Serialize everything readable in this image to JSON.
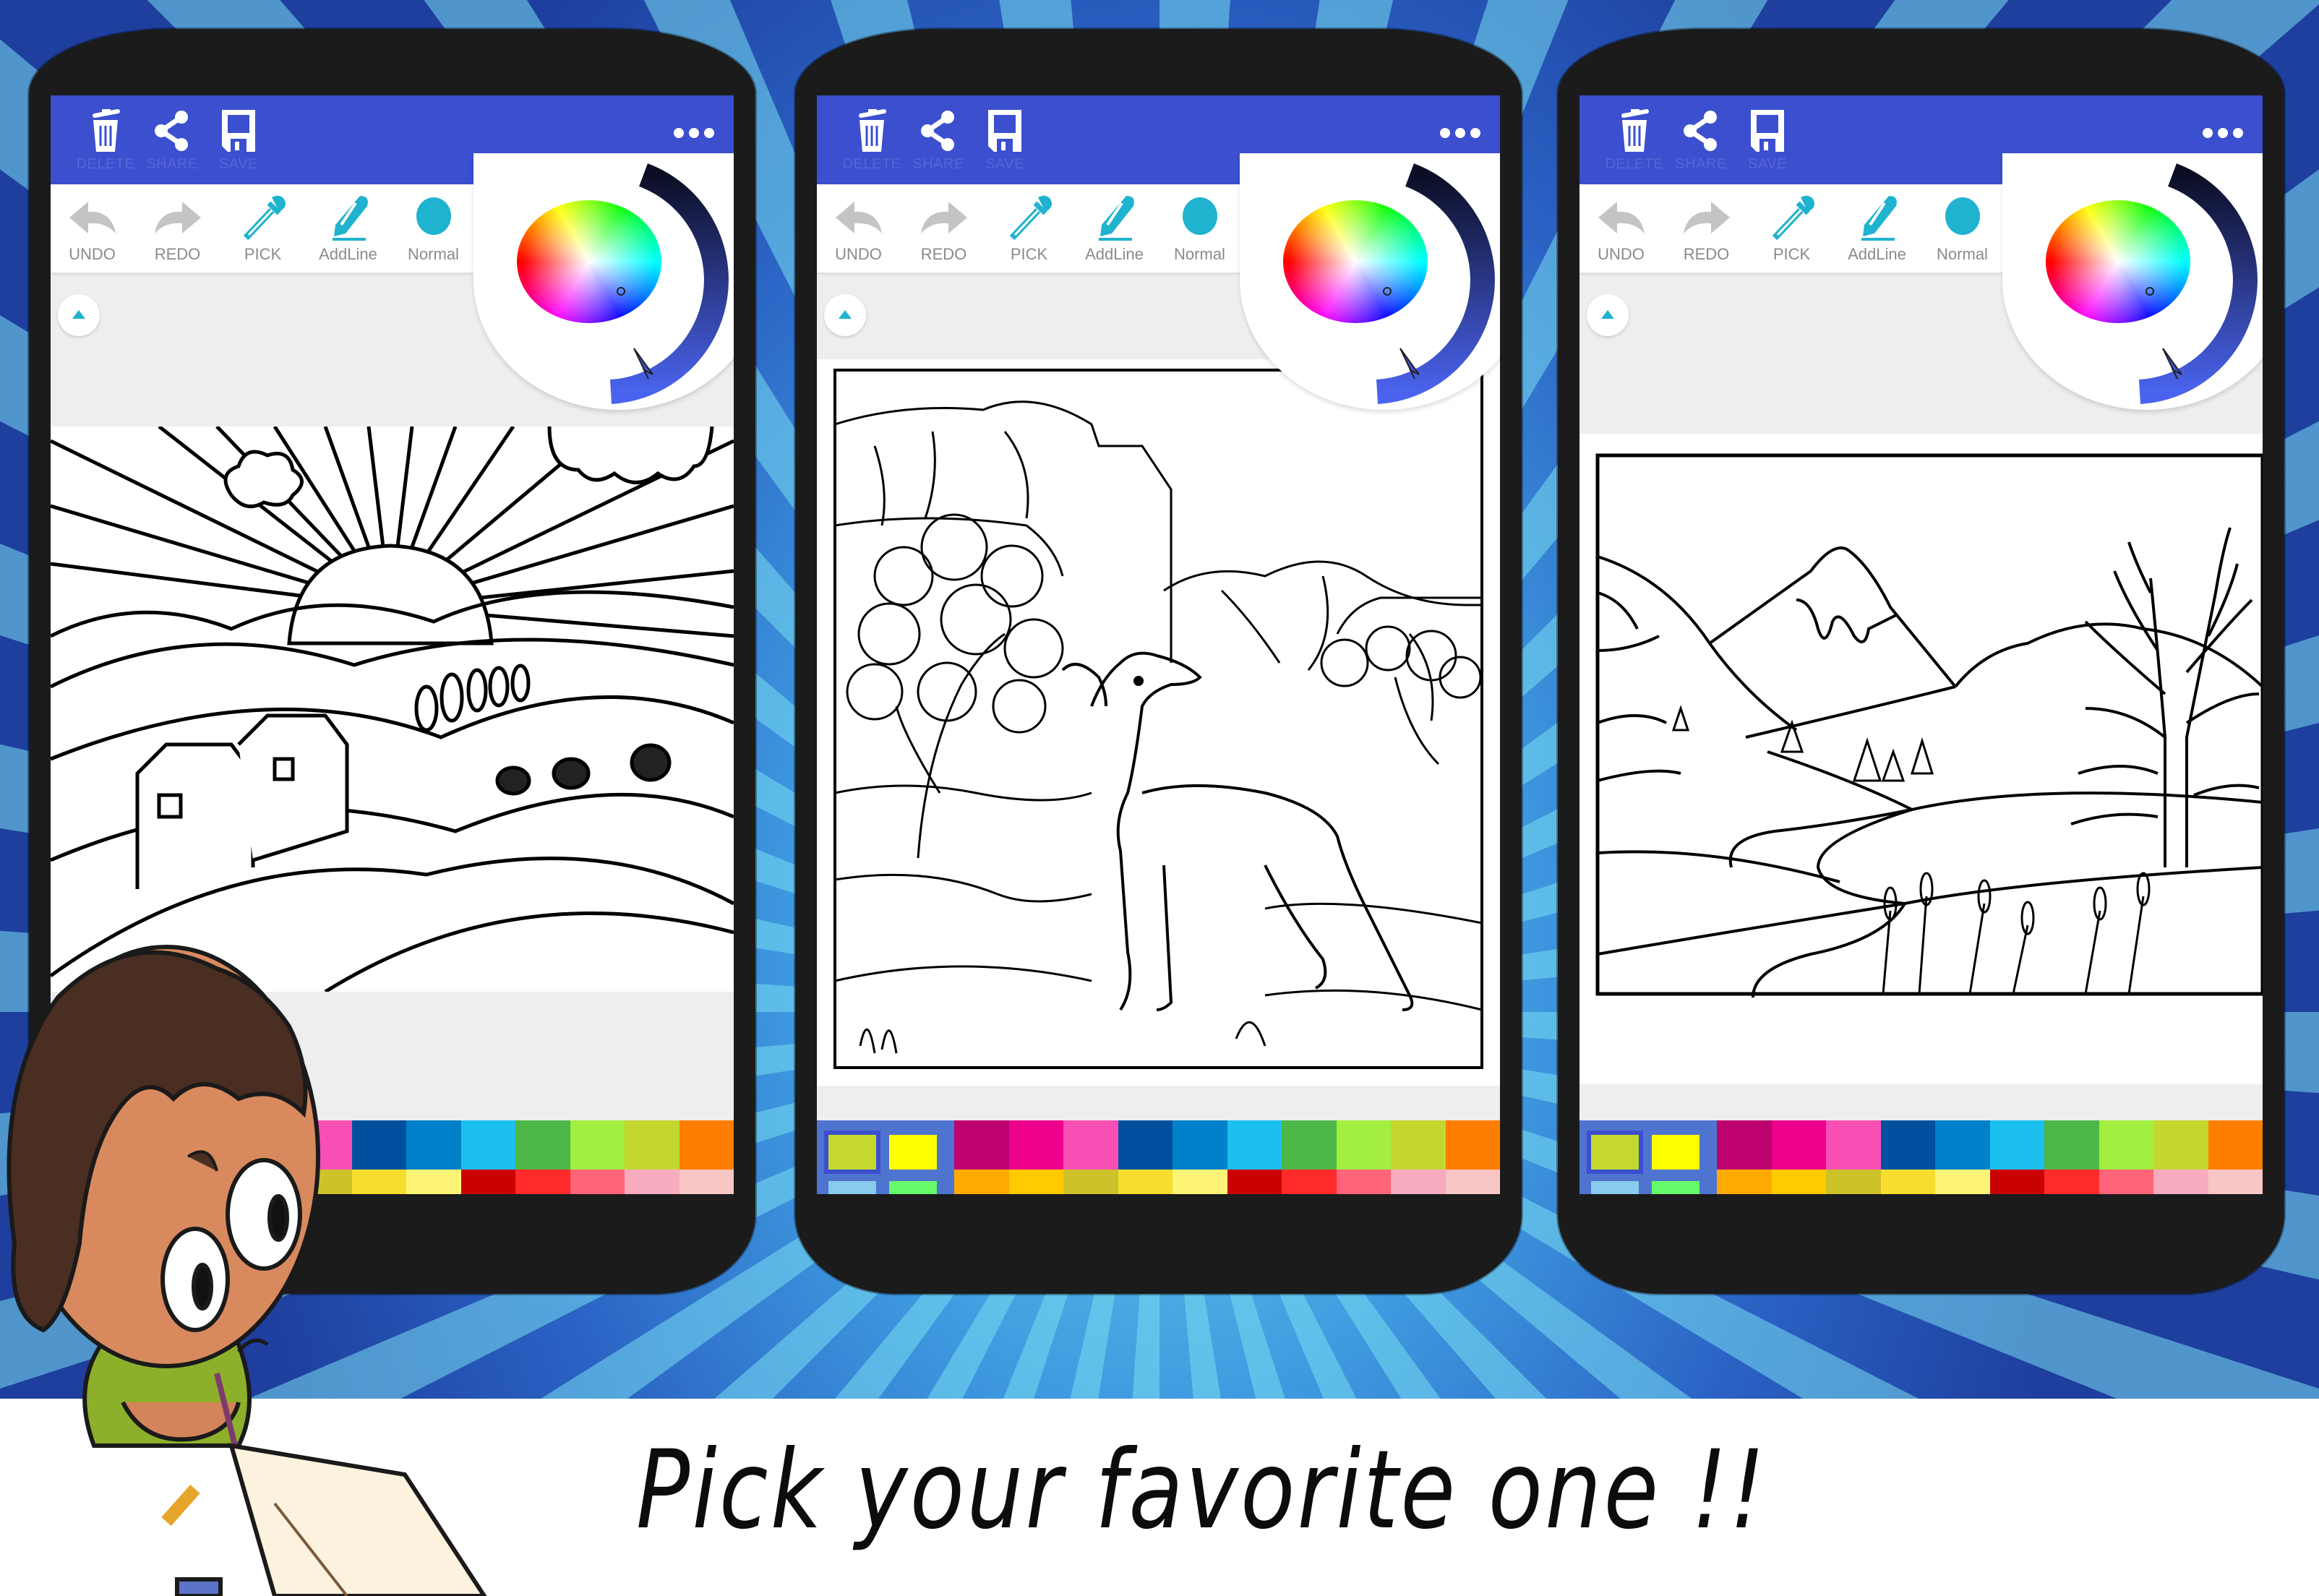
{
  "headline": "Pick your favorite one !!",
  "colors": {
    "topbar": "#3b4fcf",
    "topbar_label": "#5666d6",
    "accent": "#1fb3cf",
    "disabled_icon": "#c4c4c4",
    "phone_body": "#1b1b1b"
  },
  "topbar": {
    "buttons": [
      {
        "label": "DELETE",
        "icon": "trash-icon"
      },
      {
        "label": "SHARE",
        "icon": "share-icon"
      },
      {
        "label": "SAVE",
        "icon": "floppy-disk-icon"
      },
      {
        "label": "MORE",
        "icon": "more-dots-icon"
      }
    ]
  },
  "tools": [
    {
      "label": "UNDO",
      "icon": "undo-arrow-icon",
      "enabled": false
    },
    {
      "label": "REDO",
      "icon": "redo-arrow-icon",
      "enabled": false
    },
    {
      "label": "PICK",
      "icon": "eyedropper-icon",
      "enabled": true
    },
    {
      "label": "AddLine",
      "icon": "pencil-line-icon",
      "enabled": true
    },
    {
      "label": "Normal",
      "icon": "brush-dot-icon",
      "enabled": true
    }
  ],
  "color_picker": {
    "type": "hue-wheel-with-brightness-arc",
    "selected_hue": "blue-violet",
    "brightness_range": [
      "#0b0e24",
      "#4a63ee"
    ]
  },
  "palette": {
    "recent": [
      "#c5d82f",
      "#ffff00",
      "#87ccee",
      "#66f96a"
    ],
    "selected_recent_index": 0,
    "row1": [
      "#bd0270",
      "#ec008c",
      "#f74fb4",
      "#01509f",
      "#0181c9",
      "#1cc0ef",
      "#4db748",
      "#a3ef3f",
      "#c4d72f",
      "#ff7e00"
    ],
    "row2": [
      "#ffaa00",
      "#ffcb00",
      "#cdc22a",
      "#f6dd2e",
      "#fef577",
      "#cb0000",
      "#ff2b2b",
      "#ff6478",
      "#f8abbf",
      "#f8c7c5"
    ]
  },
  "phones": [
    {
      "name": "phone-farm-sunrise",
      "artwork": "Farm landscape with sunrise rays, clouds, houses, trees and grazing cows"
    },
    {
      "name": "phone-deer-canyon",
      "artwork": "Deer standing in rocky canyon with trees and stream"
    },
    {
      "name": "phone-mountain-river",
      "artwork": "Snow-capped mountain, winding river, bare tree and cattails"
    }
  ],
  "character": {
    "description": "Cartoon boy with curly hair holding a pencil over an open book"
  }
}
